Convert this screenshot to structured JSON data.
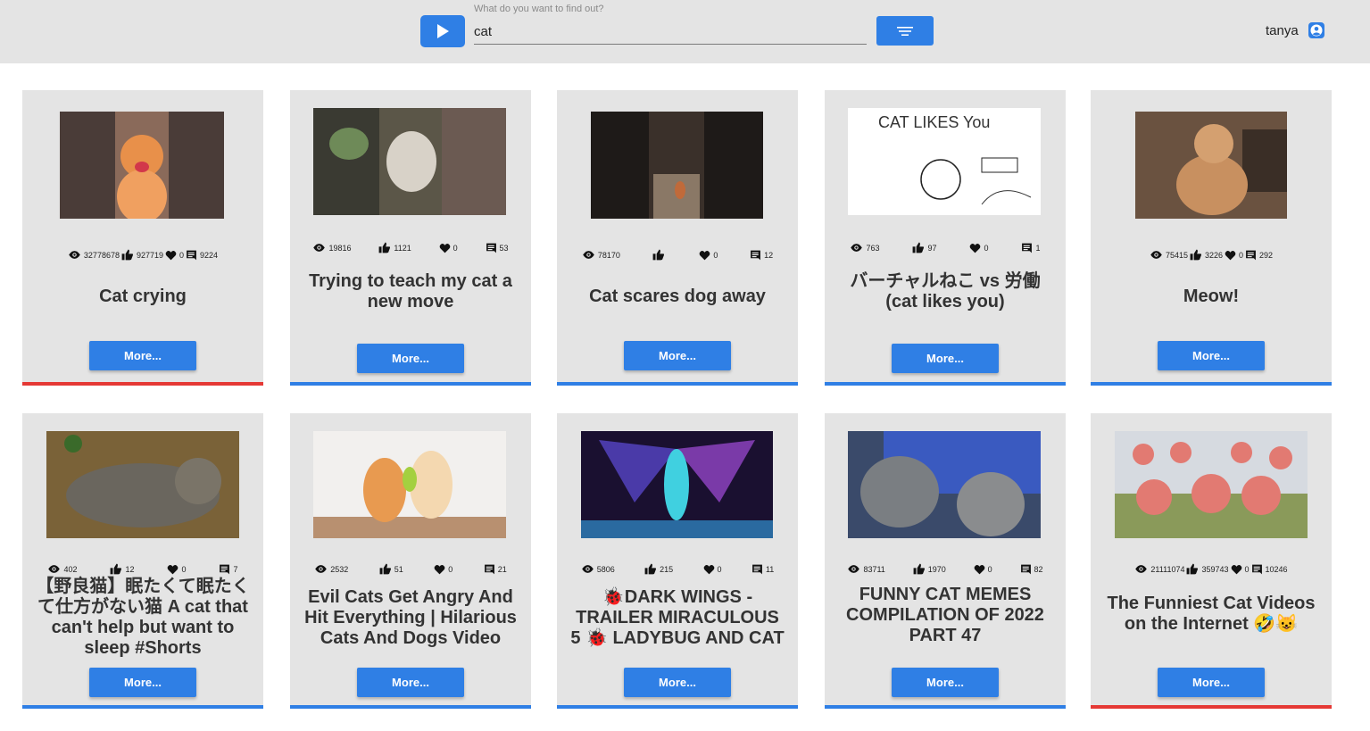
{
  "header": {
    "search_label": "What do you want to find out?",
    "search_value": "cat",
    "username": "tanya"
  },
  "colors": {
    "accent": "#2f7fe5",
    "liked": "#e53935",
    "card_bg": "#e4e4e4"
  },
  "cards": [
    {
      "views": "32778678",
      "likes": "927719",
      "hearts": "0",
      "comments": "9224",
      "title": "Cat crying",
      "more_label": "More...",
      "bar_color": "#e53935"
    },
    {
      "views": "19816",
      "likes": "1121",
      "hearts": "0",
      "comments": "53",
      "title": "Trying to teach my cat a new move",
      "more_label": "More...",
      "bar_color": "#2f7fe5"
    },
    {
      "views": "78170",
      "likes": "",
      "hearts": "0",
      "comments": "12",
      "title": "Cat scares dog away",
      "more_label": "More...",
      "bar_color": "#2f7fe5"
    },
    {
      "views": "763",
      "likes": "97",
      "hearts": "0",
      "comments": "1",
      "title": "バーチャルねこ vs 労働 (cat likes you)",
      "more_label": "More...",
      "bar_color": "#2f7fe5",
      "thumb_text": "CAT LIKES You"
    },
    {
      "views": "75415",
      "likes": "3226",
      "hearts": "0",
      "comments": "292",
      "title": "Meow!",
      "more_label": "More...",
      "bar_color": "#2f7fe5"
    },
    {
      "views": "402",
      "likes": "12",
      "hearts": "0",
      "comments": "7",
      "title": "【野良猫】眠たくて眠たくて仕方がない猫 A cat that can't help but want to sleep #Shorts",
      "more_label": "More...",
      "bar_color": "#2f7fe5"
    },
    {
      "views": "2532",
      "likes": "51",
      "hearts": "0",
      "comments": "21",
      "title": "Evil Cats Get Angry And Hit Everything | Hilarious Cats And Dogs Video",
      "more_label": "More...",
      "bar_color": "#2f7fe5"
    },
    {
      "views": "5806",
      "likes": "215",
      "hearts": "0",
      "comments": "11",
      "title": "🐞DARK WINGS - TRAILER MIRACULOUS 5 🐞 LADYBUG AND CAT",
      "more_label": "More...",
      "bar_color": "#2f7fe5"
    },
    {
      "views": "83711",
      "likes": "1970",
      "hearts": "0",
      "comments": "82",
      "title": "FUNNY CAT MEMES COMPILATION OF 2022 PART 47",
      "more_label": "More...",
      "bar_color": "#2f7fe5"
    },
    {
      "views": "21111074",
      "likes": "359743",
      "hearts": "0",
      "comments": "10246",
      "title": "The Funniest Cat Videos on the Internet 🤣😺",
      "more_label": "More...",
      "bar_color": "#e53935"
    }
  ]
}
